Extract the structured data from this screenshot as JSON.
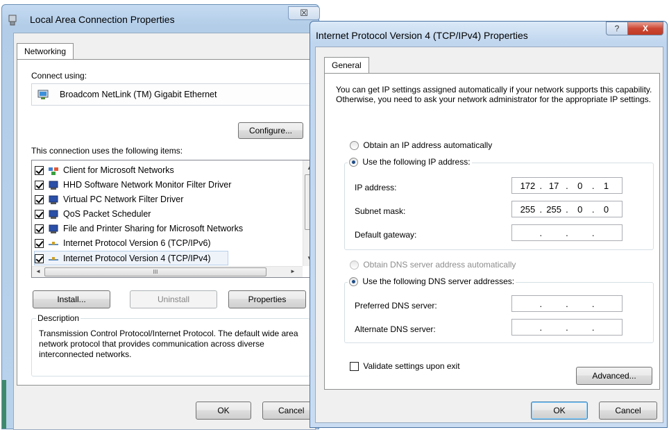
{
  "back_window": {
    "title": "Local Area Connection Properties",
    "close_glyph": "☒",
    "tab": "Networking",
    "connect_using_label": "Connect using:",
    "adapter_name": "Broadcom NetLink (TM) Gigabit Ethernet",
    "configure_label": "Configure...",
    "items_label": "This connection uses the following items:",
    "items": [
      {
        "label": "Client for Microsoft Networks",
        "checked": true,
        "icon": "client-network-icon"
      },
      {
        "label": "HHD Software Network Monitor Filter Driver",
        "checked": true,
        "icon": "network-service-icon"
      },
      {
        "label": "Virtual PC Network Filter Driver",
        "checked": true,
        "icon": "network-service-icon"
      },
      {
        "label": "QoS Packet Scheduler",
        "checked": true,
        "icon": "network-service-icon"
      },
      {
        "label": "File and Printer Sharing for Microsoft Networks",
        "checked": true,
        "icon": "network-service-icon"
      },
      {
        "label": "Internet Protocol Version 6 (TCP/IPv6)",
        "checked": true,
        "icon": "protocol-icon"
      },
      {
        "label": "Internet Protocol Version 4 (TCP/IPv4)",
        "checked": true,
        "icon": "protocol-icon",
        "selected": true
      }
    ],
    "install_label": "Install...",
    "uninstall_label": "Uninstall",
    "properties_label": "Properties",
    "description_title": "Description",
    "description_text": "Transmission Control Protocol/Internet Protocol. The default wide area network protocol that provides communication across diverse interconnected networks.",
    "ok_label": "OK",
    "cancel_label": "Cancel",
    "hscroll_grip": "III"
  },
  "front_window": {
    "title": "Internet Protocol Version 4 (TCP/IPv4) Properties",
    "help_glyph": "?",
    "close_glyph": "X",
    "tab": "General",
    "intro_text": "You can get IP settings assigned automatically if your network supports this capability. Otherwise, you need to ask your network administrator for the appropriate IP settings.",
    "ip_auto_label": "Obtain an IP address automatically",
    "ip_manual_label": "Use the following IP address:",
    "ip_address_label": "IP address:",
    "ip_address": [
      "172",
      "17",
      "0",
      "1"
    ],
    "subnet_label": "Subnet mask:",
    "subnet": [
      "255",
      "255",
      "0",
      "0"
    ],
    "gateway_label": "Default gateway:",
    "gateway": [
      "",
      "",
      "",
      ""
    ],
    "dns_auto_label": "Obtain DNS server address automatically",
    "dns_manual_label": "Use the following DNS server addresses:",
    "dns_pref_label": "Preferred DNS server:",
    "dns_pref": [
      "",
      "",
      "",
      ""
    ],
    "dns_alt_label": "Alternate DNS server:",
    "dns_alt": [
      "",
      "",
      "",
      ""
    ],
    "validate_label": "Validate settings upon exit",
    "advanced_label": "Advanced...",
    "ok_label": "OK",
    "cancel_label": "Cancel"
  },
  "colors": {
    "frame": "#b9d2ec",
    "close_red": "#cc4733",
    "radio_dot": "#1e4d86"
  }
}
